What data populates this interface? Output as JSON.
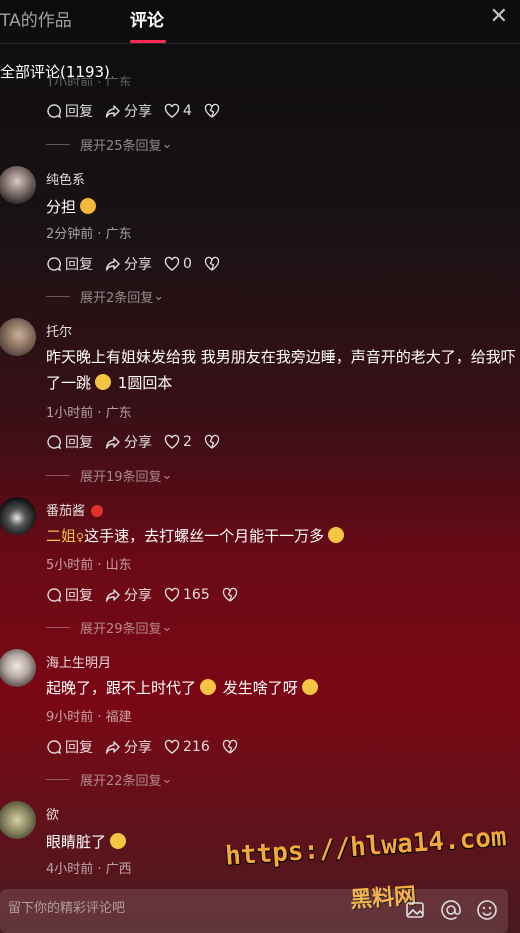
{
  "tabs": {
    "works": "TA的作品",
    "comments": "评论"
  },
  "comment_count_label": "全部评论(1193)",
  "partial_meta": "1小时前 · 广东",
  "labels": {
    "reply": "回复",
    "share": "分享"
  },
  "top_actions": {
    "likes": "4"
  },
  "top_expand": "展开25条回复",
  "comments": [
    {
      "user": "纯色系",
      "text_a": "分担",
      "text_b": "",
      "meta": "2分钟前 · 广东",
      "likes": "0",
      "expand": "展开2条回复"
    },
    {
      "user": "托尔",
      "text_a": "昨天晚上有姐妹发给我 我男朋友在我旁边睡，声音开的老大了，给我吓了一跳",
      "text_b": "1圆回本",
      "meta": "1小时前 · 广东",
      "likes": "2",
      "expand": "展开19条回复"
    },
    {
      "user": "番茄酱",
      "reply_tag": "二姐",
      "text_a": "这手速，去打螺丝一个月能干一万多",
      "text_b": "",
      "meta": "5小时前 · 山东",
      "likes": "165",
      "expand": "展开29条回复"
    },
    {
      "user": "海上生明月",
      "text_a": "起晚了，跟不上时代了",
      "text_b": "发生啥了呀",
      "meta": "9小时前 · 福建",
      "likes": "216",
      "expand": "展开22条回复"
    },
    {
      "user": "欲",
      "text_a": "眼睛脏了",
      "text_b": "",
      "meta": "4小时前 · 广西"
    }
  ],
  "input": {
    "placeholder": "留下你的精彩评论吧"
  },
  "watermark": {
    "url": "https://hlwa14.com",
    "logo": "黑料网"
  },
  "colors": {
    "accent": "#fe2c55",
    "reply_tag": "#f5c242",
    "watermark": "#f2a93b"
  },
  "icons": [
    "comment-icon",
    "share-icon",
    "heart-icon",
    "dislike-icon",
    "chevron-down-icon",
    "image-icon",
    "at-icon",
    "emoji-icon",
    "close-icon"
  ]
}
